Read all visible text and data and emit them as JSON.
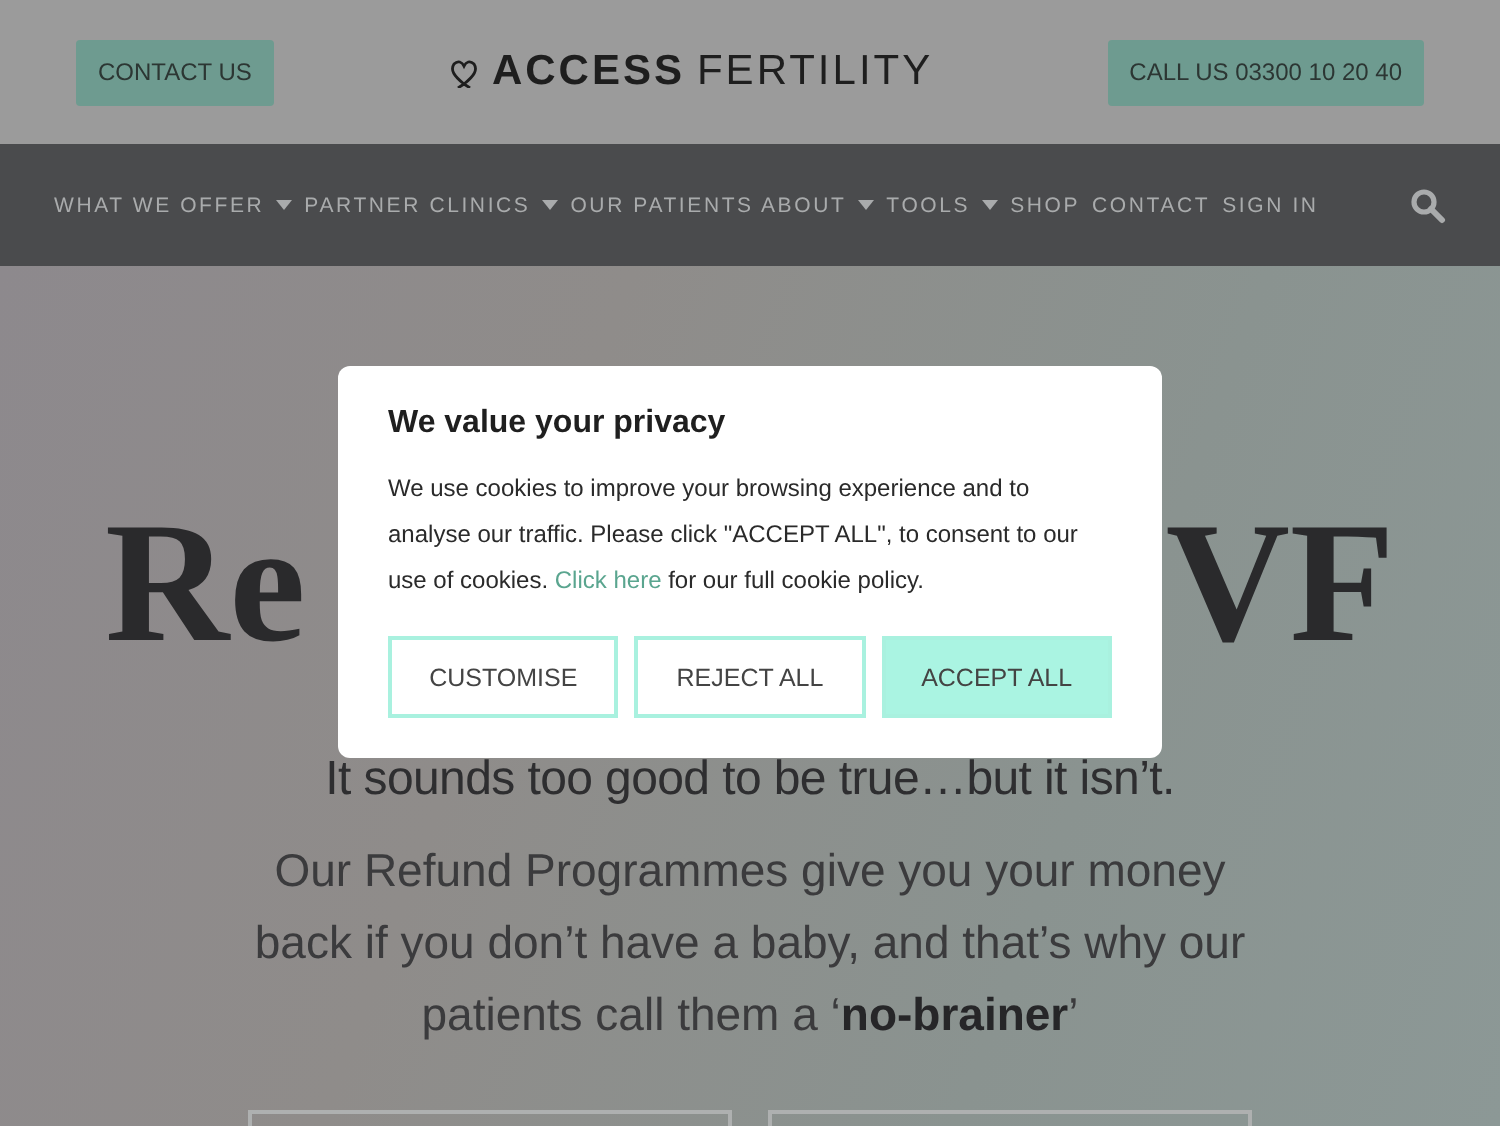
{
  "header": {
    "contact_button": "CONTACT US",
    "logo": {
      "bold": "ACCESS",
      "light": "FERTILITY"
    },
    "call_button": "CALL US 03300 10 20 40"
  },
  "nav": {
    "items": [
      {
        "label": "WHAT WE OFFER",
        "dropdown": true
      },
      {
        "label": "PARTNER CLINICS",
        "dropdown": true
      },
      {
        "label": "OUR PATIENTS ABOUT",
        "dropdown": true
      },
      {
        "label": "TOOLS",
        "dropdown": true
      },
      {
        "label": "SHOP",
        "dropdown": false
      },
      {
        "label": "CONTACT",
        "dropdown": false
      },
      {
        "label": "SIGN IN",
        "dropdown": false
      }
    ]
  },
  "hero": {
    "heading_visible_start": "Re",
    "heading_visible_end": "VF",
    "subtitle": "It sounds too good to be true…but it isn’t.",
    "paragraph": "Our Refund Programmes give you your money back if you don’t have a baby, and that’s why our patients call them a ‘**no-brainer**’"
  },
  "cookie_dialog": {
    "title": "We value your privacy",
    "text_before_link": "We use cookies to improve your browsing experience and to analyse our traffic. Please click \"ACCEPT ALL\", to consent to our use of cookies.",
    "link": "Click here",
    "text_after_link": "for our full cookie policy.",
    "buttons": [
      {
        "label": "CUSTOMISE",
        "kind": "outline"
      },
      {
        "label": "REJECT ALL",
        "kind": "outline"
      },
      {
        "label": "ACCEPT ALL",
        "kind": "filled"
      }
    ]
  }
}
